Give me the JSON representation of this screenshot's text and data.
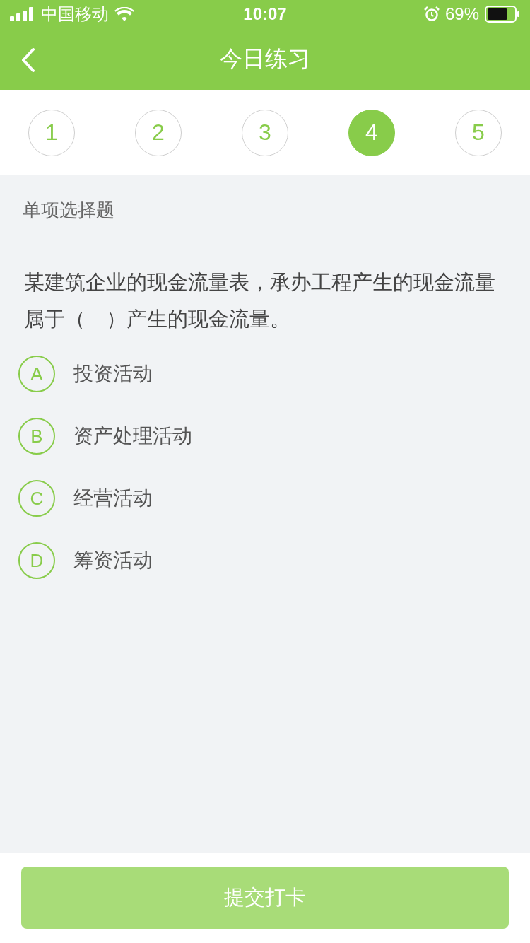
{
  "status_bar": {
    "carrier": "中国移动",
    "time": "10:07",
    "battery": "69%"
  },
  "nav": {
    "title": "今日练习"
  },
  "steps": [
    {
      "label": "1",
      "selected": false
    },
    {
      "label": "2",
      "selected": false
    },
    {
      "label": "3",
      "selected": false
    },
    {
      "label": "4",
      "selected": true
    },
    {
      "label": "5",
      "selected": false
    }
  ],
  "section": {
    "title": "单项选择题"
  },
  "question": {
    "text": "某建筑企业的现金流量表，承办工程产生的现金流量属于（　）产生的现金流量。",
    "options": [
      {
        "letter": "A",
        "text": "投资活动",
        "selected": false
      },
      {
        "letter": "B",
        "text": "资产处理活动",
        "selected": false
      },
      {
        "letter": "C",
        "text": "经营活动",
        "selected": false
      },
      {
        "letter": "D",
        "text": "筹资活动",
        "selected": false
      }
    ]
  },
  "submit": {
    "label": "提交打卡",
    "disabled": true
  }
}
